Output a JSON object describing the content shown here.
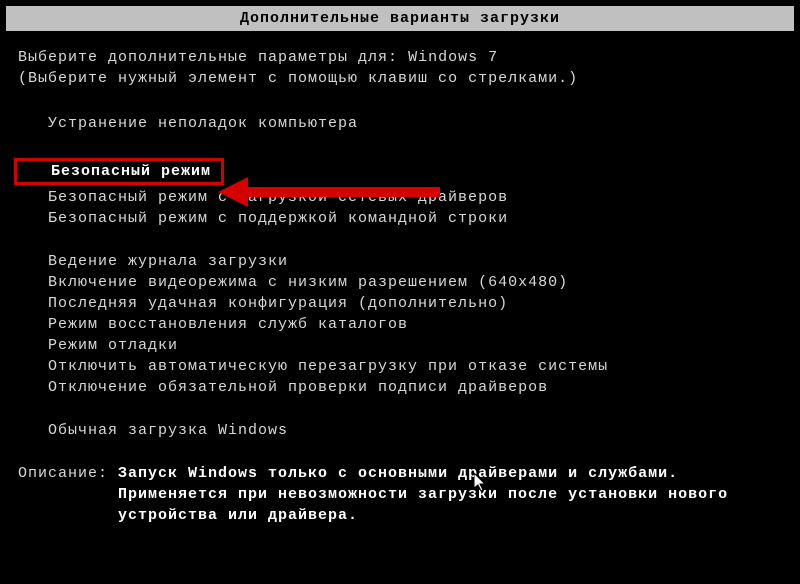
{
  "title": "Дополнительные варианты загрузки",
  "intro": {
    "line1_prefix": "Выберите дополнительные параметры для: ",
    "os_name": "Windows 7",
    "line2": "(Выберите нужный элемент с помощью клавиш со стрелками.)"
  },
  "options": {
    "group1": [
      "Устранение неполадок компьютера"
    ],
    "selected": "Безопасный режим",
    "group2": [
      "Безопасный режим с загрузкой сетевых драйверов",
      "Безопасный режим с поддержкой командной строки"
    ],
    "group3": [
      "Ведение журнала загрузки",
      "Включение видеорежима с низким разрешением (640x480)",
      "Последняя удачная конфигурация (дополнительно)",
      "Режим восстановления служб каталогов",
      "Режим отладки",
      "Отключить автоматическую перезагрузку при отказе системы",
      "Отключение обязательной проверки подписи драйверов"
    ],
    "group4": [
      "Обычная загрузка Windows"
    ]
  },
  "description": {
    "label": "Описание: ",
    "line1": "Запуск Windows только с основными драйверами и службами.",
    "line2": "Применяется при невозможности загрузки после установки нового",
    "line3": "устройства или драйвера."
  }
}
